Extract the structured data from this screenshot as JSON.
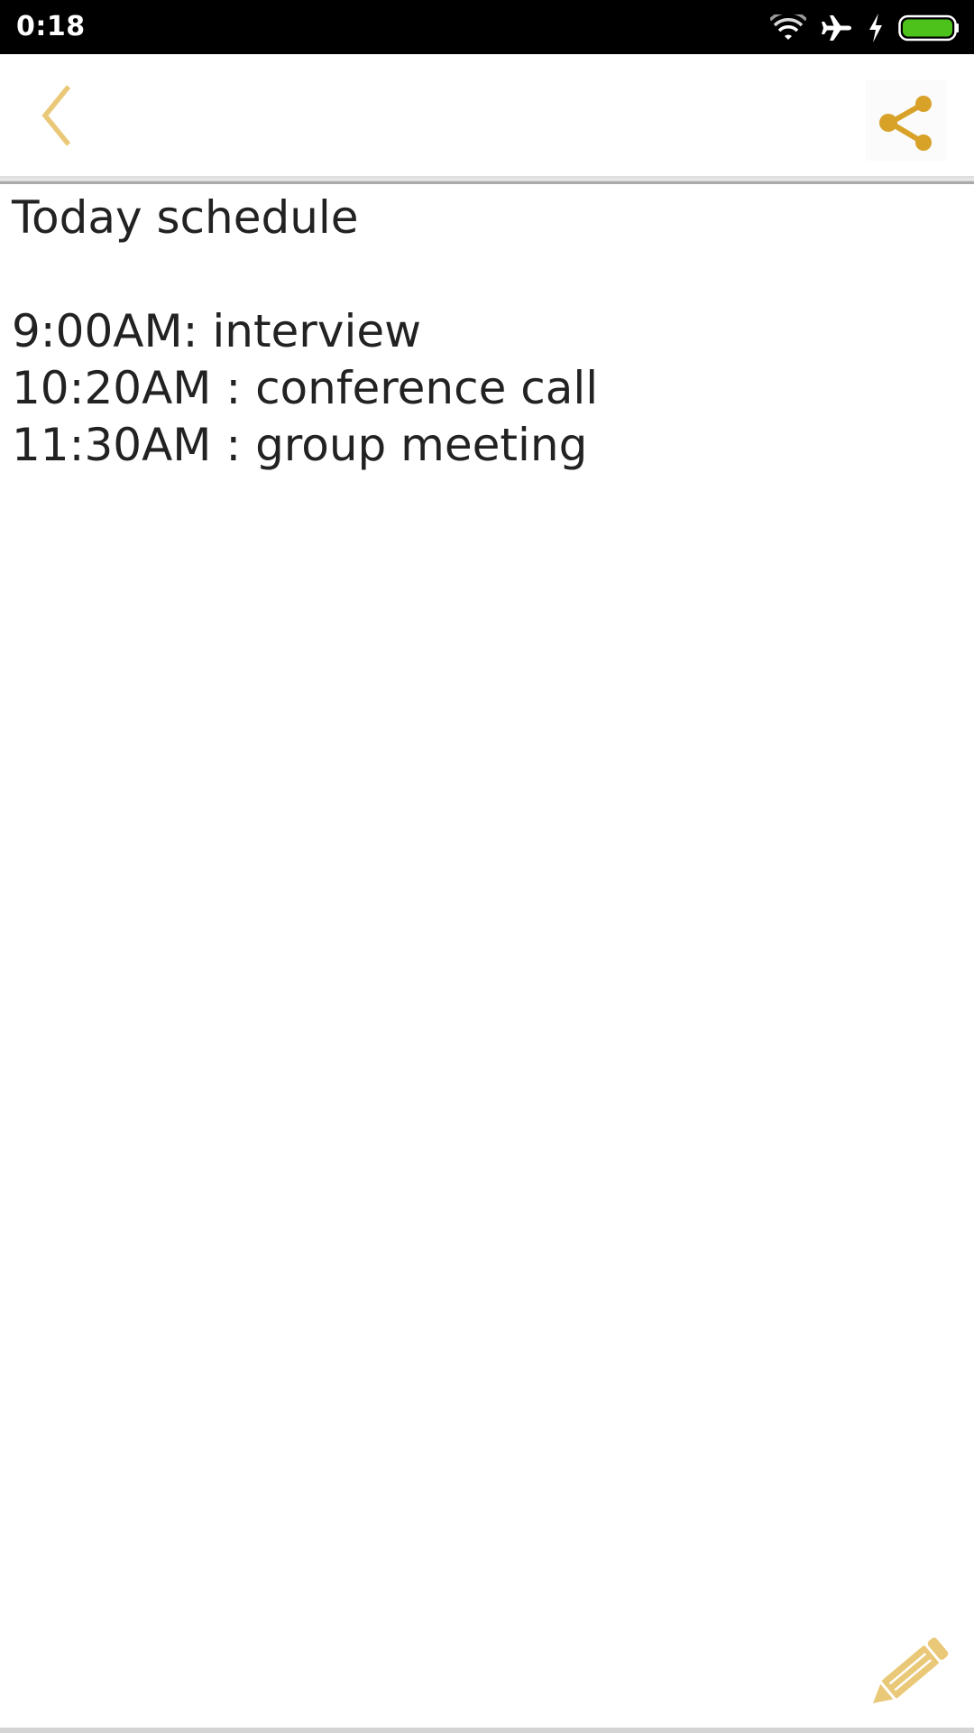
{
  "status_bar": {
    "time": "0:18",
    "icons": [
      "wifi-icon",
      "airplane-mode-icon",
      "charging-icon",
      "battery-icon"
    ],
    "battery_color": "#4cc21a"
  },
  "toolbar": {
    "back_icon": "chevron-left-icon",
    "share_icon": "share-icon",
    "accent_color": "#d8a128",
    "accent_light_color": "#e9c878"
  },
  "note": {
    "lines": [
      "Today schedule",
      "",
      "9:00AM: interview",
      "10:20AM : conference call",
      "11:30AM : group meeting"
    ]
  },
  "fab": {
    "icon": "pencil-icon"
  }
}
